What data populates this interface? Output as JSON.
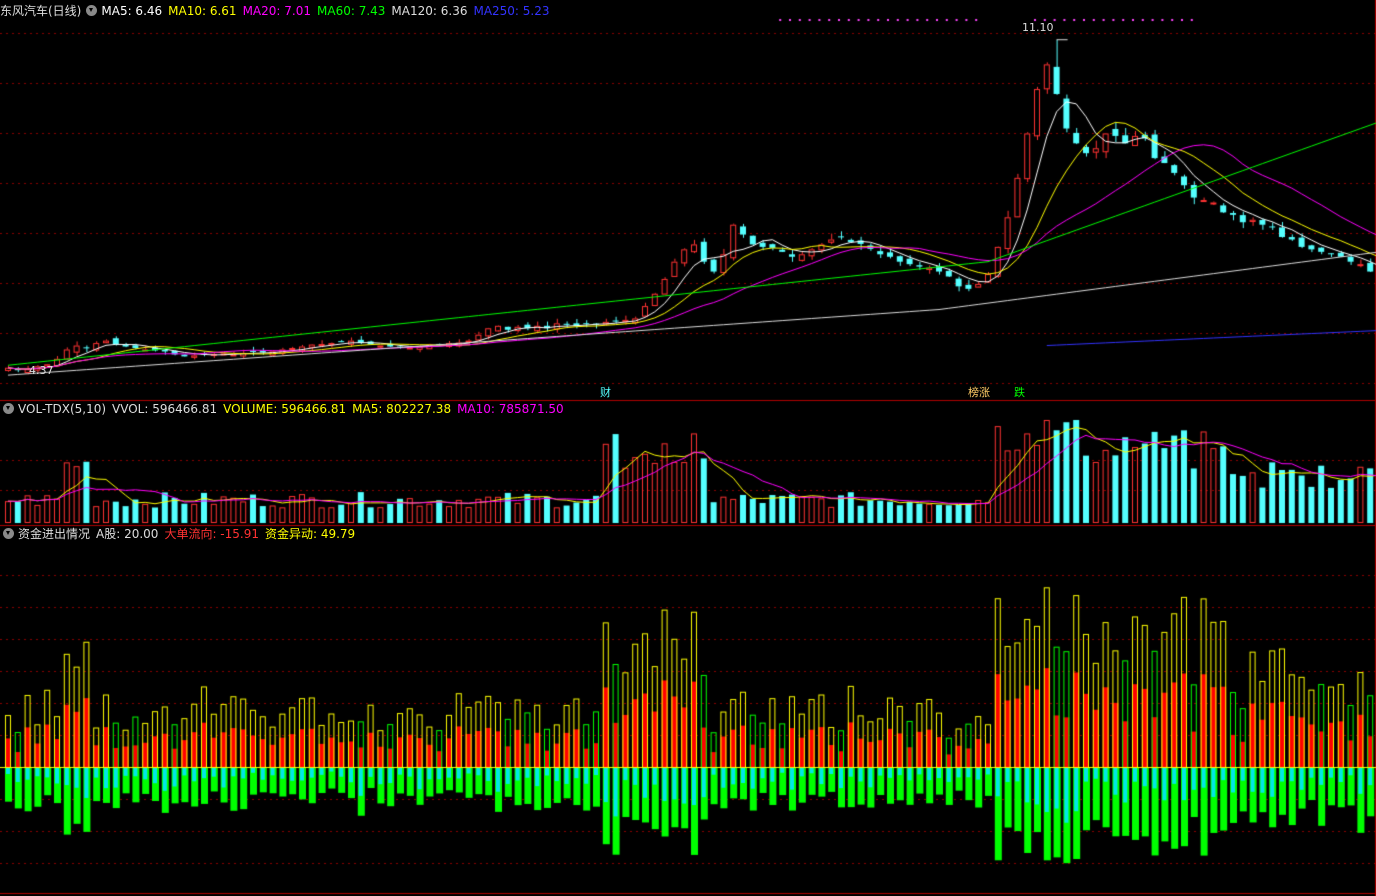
{
  "title": "东风汽车(日线)",
  "colors": {
    "up": "#ff3232",
    "down": "#54ffff",
    "ma5": "#ffffff",
    "ma10": "#ffff00",
    "ma20": "#ff00ff",
    "ma60": "#00ff00",
    "ma120": "#dddddd",
    "ma250": "#3333ff",
    "grid": "#8b0000",
    "fundGreen": "#00ff00",
    "fundCyan": "#00e8e8",
    "fundRed": "#ff0000",
    "fundYellow": "#ffff00"
  },
  "price_panel": {
    "ma_labels": [
      {
        "text": "MA5: 6.46",
        "color": "#ffffff"
      },
      {
        "text": "MA10: 6.61",
        "color": "#ffff00"
      },
      {
        "text": "MA20: 7.01",
        "color": "#ff00ff"
      },
      {
        "text": "MA60: 7.43",
        "color": "#00ff00"
      },
      {
        "text": "MA120: 6.36",
        "color": "#dddddd"
      },
      {
        "text": "MA250: 5.23",
        "color": "#3333ff"
      }
    ],
    "high_label": "11.10",
    "low_label": "4.37",
    "event_tags": [
      {
        "text": "财",
        "color": "#54ffff"
      },
      {
        "text": "榜涨",
        "color": "#ffcc66"
      },
      {
        "text": "跌",
        "color": "#00ff00"
      }
    ]
  },
  "volume_panel": {
    "labels": [
      {
        "text": "VOL-TDX(5,10)",
        "color": "#dddddd"
      },
      {
        "text": "VVOL: 596466.81",
        "color": "#dddddd"
      },
      {
        "text": "VOLUME: 596466.81",
        "color": "#ffff00"
      },
      {
        "text": "MA5: 802227.38",
        "color": "#ffff00"
      },
      {
        "text": "MA10: 785871.50",
        "color": "#ff00ff"
      }
    ]
  },
  "fund_panel": {
    "labels": [
      {
        "text": "资金进出情况",
        "color": "#dddddd"
      },
      {
        "text": "A股: 20.00",
        "color": "#dddddd"
      },
      {
        "text": "大单流向: -15.91",
        "color": "#ff3232"
      },
      {
        "text": "资金异动: 49.79",
        "color": "#ffff00"
      }
    ]
  },
  "chart_data": {
    "type": "candlestick",
    "title": "东风汽车(日线)",
    "closes": [
      4.45,
      4.4,
      4.42,
      4.48,
      4.52,
      4.63,
      4.82,
      4.9,
      4.85,
      4.95,
      5.0,
      4.92,
      4.88,
      4.85,
      4.82,
      4.8,
      4.78,
      4.72,
      4.68,
      4.7,
      4.72,
      4.73,
      4.74,
      4.72,
      4.75,
      4.77,
      4.76,
      4.78,
      4.82,
      4.85,
      4.88,
      4.92,
      4.93,
      4.95,
      4.97,
      5.0,
      4.95,
      4.92,
      4.9,
      4.88,
      4.86,
      4.86,
      4.88,
      4.92,
      4.93,
      4.95,
      4.96,
      5.0,
      5.12,
      5.25,
      5.3,
      5.22,
      5.28,
      5.25,
      5.3,
      5.25,
      5.35,
      5.32,
      5.3,
      5.35,
      5.34,
      5.38,
      5.4,
      5.42,
      5.45,
      5.7,
      5.95,
      6.25,
      6.6,
      6.85,
      6.95,
      6.6,
      6.4,
      6.75,
      7.35,
      7.15,
      6.95,
      6.9,
      6.88,
      6.8,
      6.7,
      6.75,
      6.85,
      6.95,
      7.05,
      7.1,
      7.0,
      6.96,
      6.86,
      6.75,
      6.7,
      6.6,
      6.55,
      6.5,
      6.48,
      6.4,
      6.3,
      6.1,
      6.05,
      6.15,
      6.35,
      6.9,
      7.5,
      8.3,
      9.2,
      10.1,
      10.6,
      10.0,
      9.3,
      9.0,
      8.8,
      8.9,
      9.2,
      9.15,
      9.0,
      9.15,
      9.1,
      8.7,
      8.6,
      8.4,
      8.15,
      7.9,
      7.85,
      7.8,
      7.6,
      7.55,
      7.4,
      7.45,
      7.35,
      7.3,
      7.1,
      7.05,
      6.9,
      6.85,
      6.8,
      6.75,
      6.7,
      6.6,
      6.55,
      6.4,
      6.3,
      6.4,
      6.5
    ]
  }
}
